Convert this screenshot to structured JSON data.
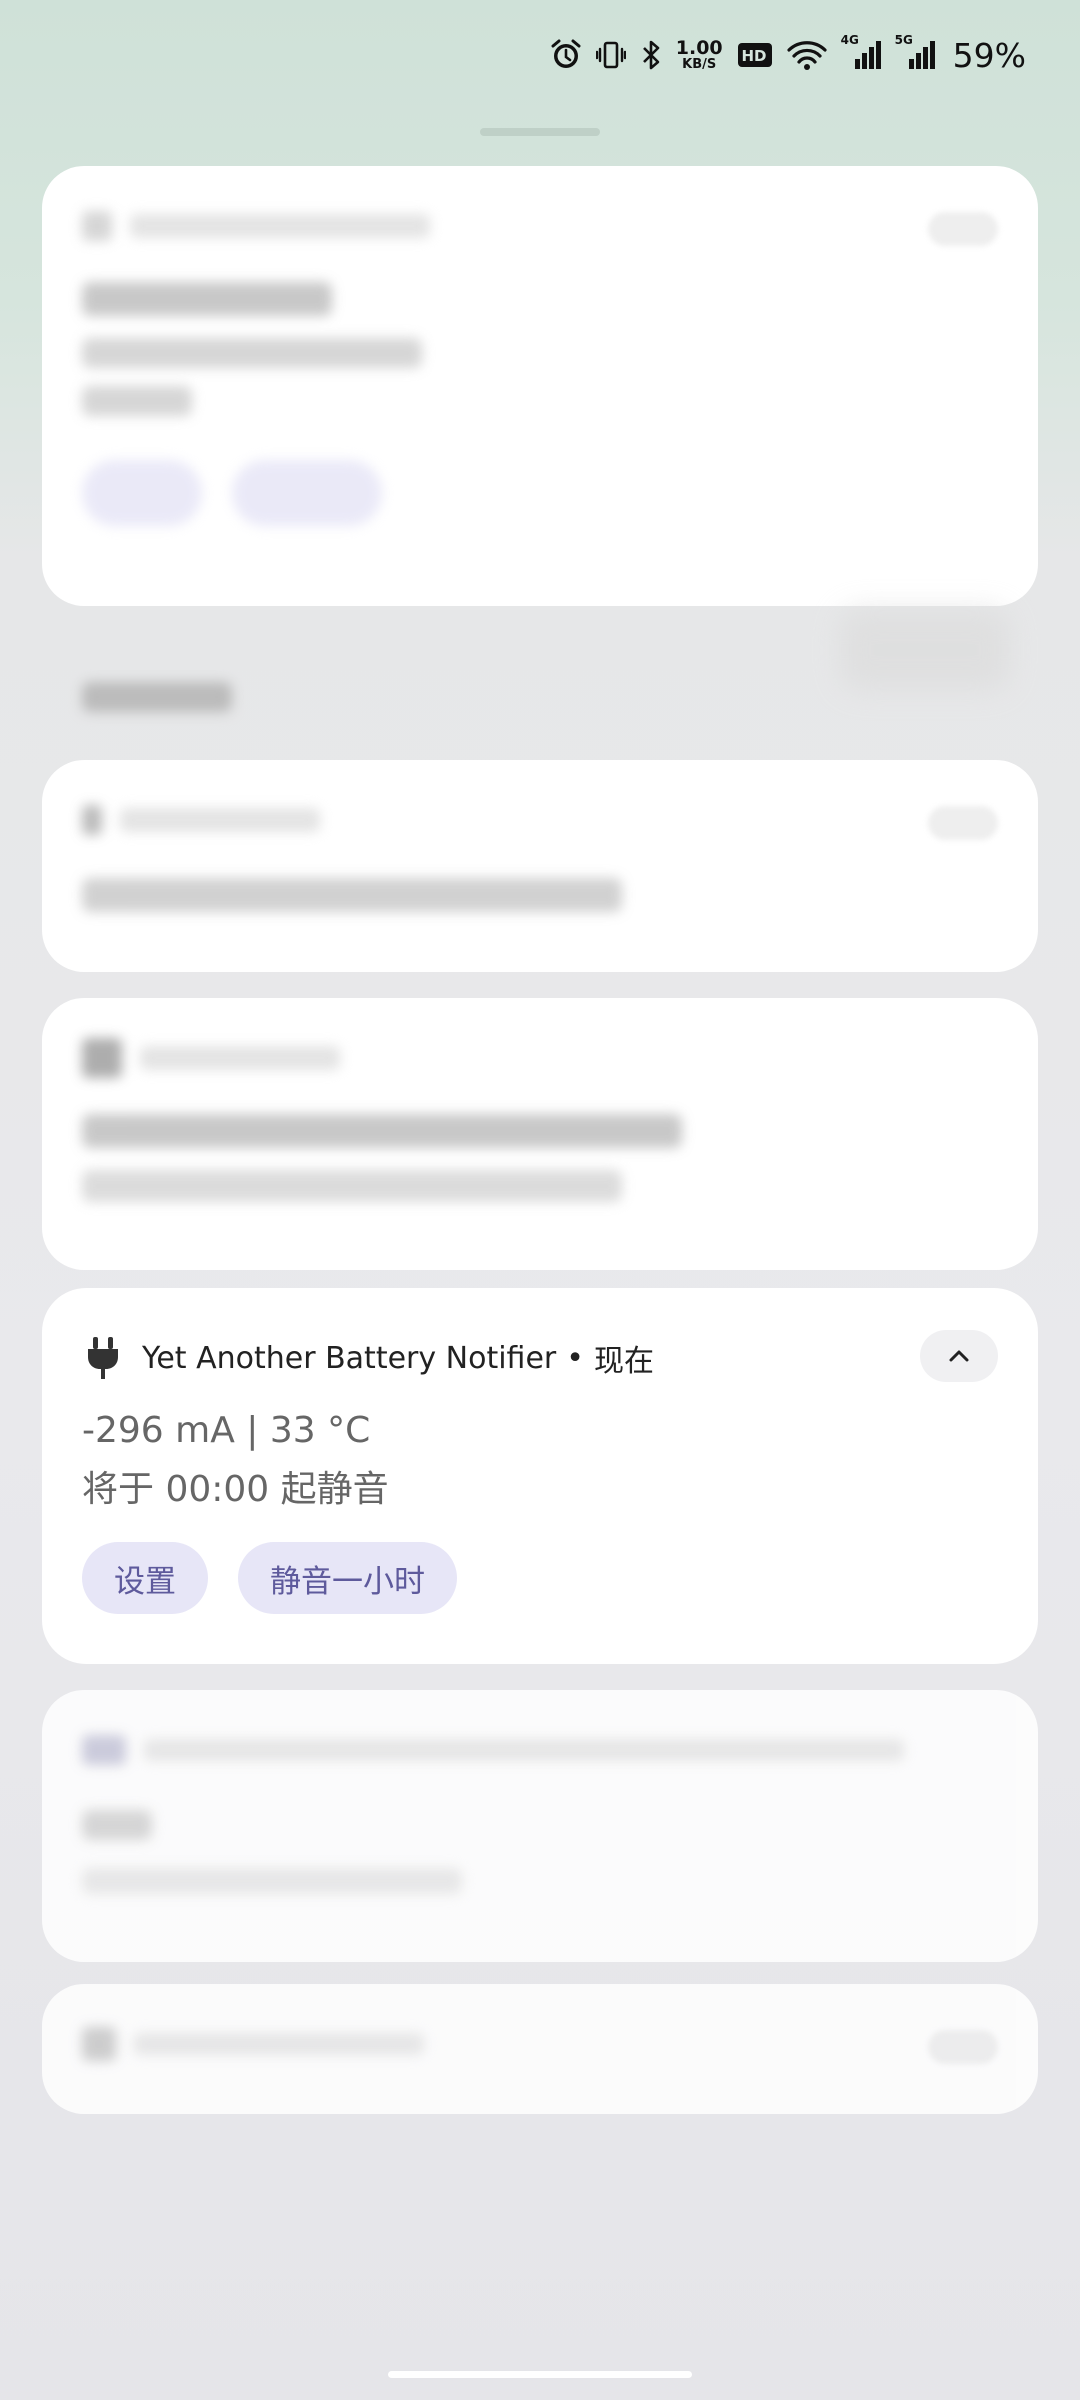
{
  "status_bar": {
    "icons": [
      "alarm-icon",
      "vibrate-icon",
      "bluetooth-icon",
      "hd-icon",
      "wifi-icon",
      "signal-4g-icon",
      "signal-5g-icon"
    ],
    "net_speed_value": "1.00",
    "net_speed_unit": "KB/S",
    "net_tag_4g": "4G",
    "net_tag_5g": "5G",
    "battery": "59%"
  },
  "notification": {
    "icon": "plug-icon",
    "app_name": "Yet Another Battery Notifier",
    "separator": "•",
    "time": "现在",
    "line1": "-296 mA | 33 °C",
    "line2": "将于 00:00 起静音",
    "actions": {
      "settings": "设置",
      "mute_hour": "静音一小时"
    },
    "accent": "#e7e6f7"
  }
}
